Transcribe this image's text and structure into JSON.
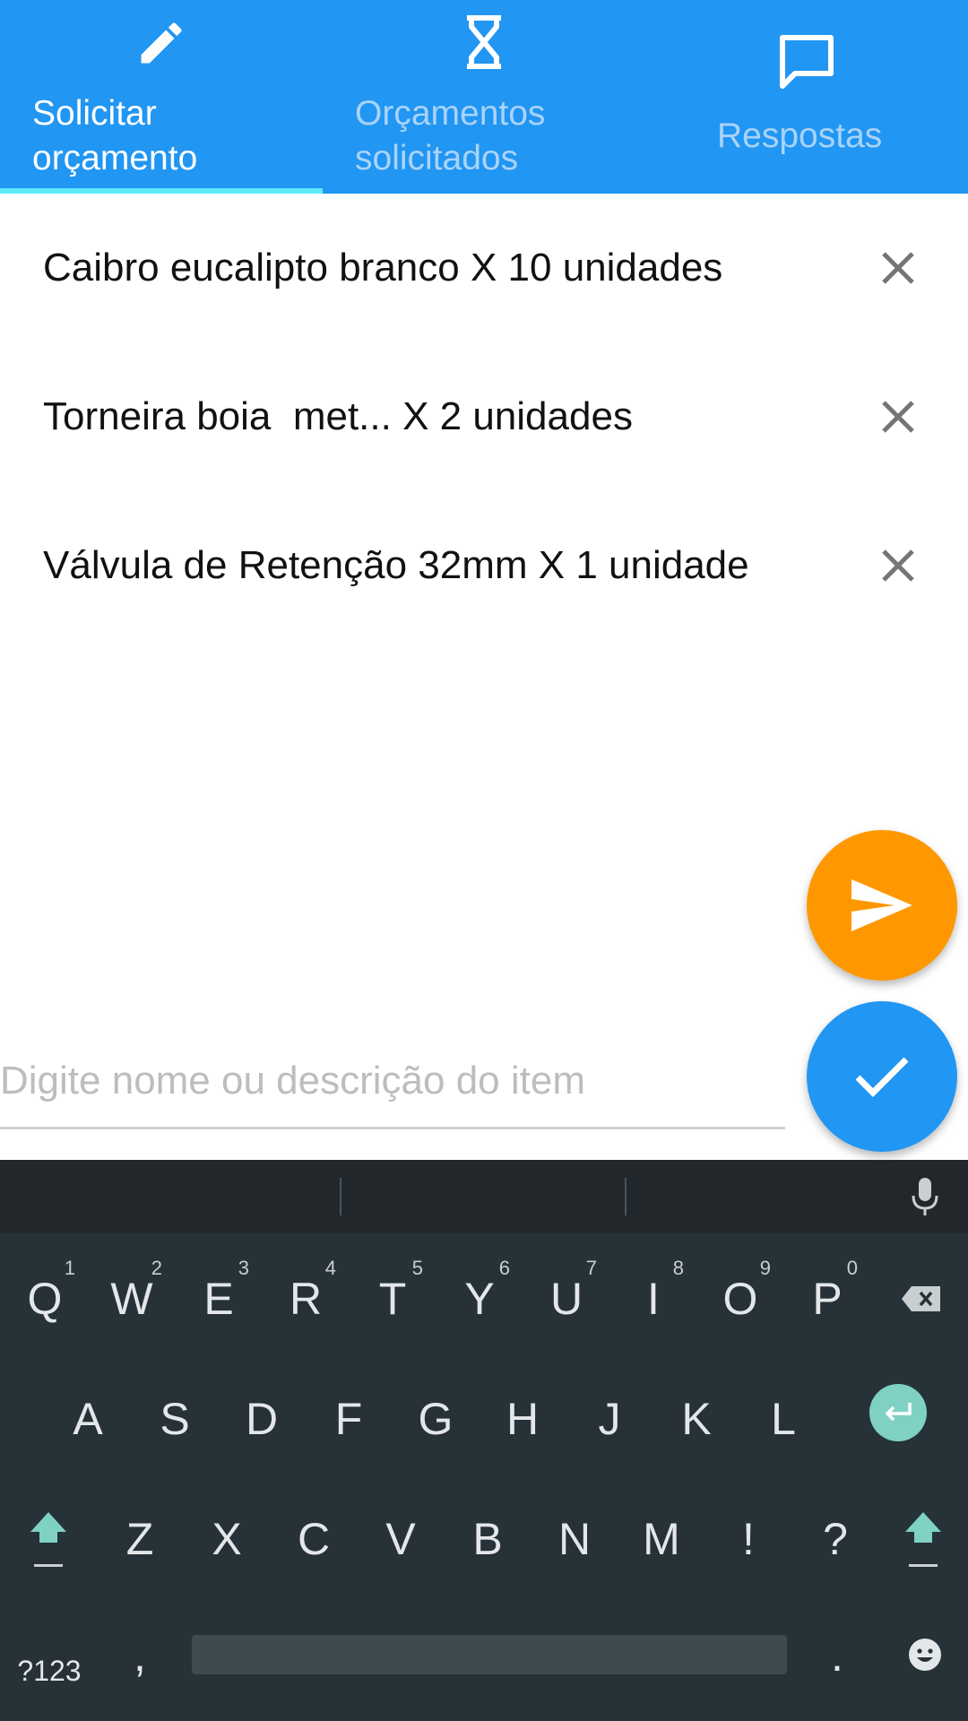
{
  "tabs": [
    {
      "label": "Solicitar\norçamento",
      "icon": "pencil-icon",
      "selected": true
    },
    {
      "label": "Orçamentos\nsolicitados",
      "icon": "hourglass-icon",
      "selected": false
    },
    {
      "label": "Respostas",
      "icon": "chat-bubble-icon",
      "selected": false
    }
  ],
  "items": [
    {
      "text": "Caibro eucalipto branco X 10 unidades"
    },
    {
      "text": "Torneira boia  met... X 2 unidades"
    },
    {
      "text": "Válvula de Retenção 32mm X 1 unidade"
    }
  ],
  "input": {
    "placeholder": "Digite nome ou descrição do item",
    "value": ""
  },
  "buttons": {
    "send_icon": "send-icon",
    "confirm_icon": "check-icon"
  },
  "colors": {
    "primary": "#2196F3",
    "accent": "#FF9800",
    "tab_indicator": "#5FEAF5",
    "keyboard_bg": "#263238",
    "enter_key": "#7FD1C3"
  },
  "keyboard": {
    "row1": [
      {
        "key": "Q",
        "hint": "1"
      },
      {
        "key": "W",
        "hint": "2"
      },
      {
        "key": "E",
        "hint": "3"
      },
      {
        "key": "R",
        "hint": "4"
      },
      {
        "key": "T",
        "hint": "5"
      },
      {
        "key": "Y",
        "hint": "6"
      },
      {
        "key": "U",
        "hint": "7"
      },
      {
        "key": "I",
        "hint": "8"
      },
      {
        "key": "O",
        "hint": "9"
      },
      {
        "key": "P",
        "hint": "0"
      }
    ],
    "row2": [
      "A",
      "S",
      "D",
      "F",
      "G",
      "H",
      "J",
      "K",
      "L"
    ],
    "row3": [
      "Z",
      "X",
      "C",
      "V",
      "B",
      "N",
      "M",
      "!",
      "?"
    ],
    "symbols_label": "?123",
    "comma_label": ",",
    "period_label": "."
  }
}
